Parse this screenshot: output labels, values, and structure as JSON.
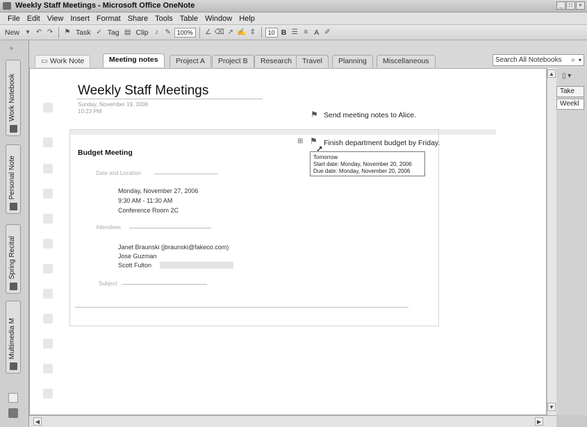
{
  "window": {
    "title": "Weekly Staff Meetings - Microsoft Office OneNote"
  },
  "menu": [
    "File",
    "Edit",
    "View",
    "Insert",
    "Format",
    "Share",
    "Tools",
    "Table",
    "Window",
    "Help"
  ],
  "toolbar": {
    "new_label": "New",
    "task_label": "Task",
    "tag_label": "Tag",
    "clip_label": "Clip",
    "zoom_value": "100%",
    "font_size": "10",
    "bold_label": "B",
    "font_color_label": "A"
  },
  "notebooks": [
    {
      "label": "Work Notebook"
    },
    {
      "label": "Personal Note"
    },
    {
      "label": "Spring Recital"
    },
    {
      "label": "Multimedia M"
    }
  ],
  "section_tabs": [
    {
      "label": "Work Note",
      "active": false
    },
    {
      "label": "Meeting notes",
      "active": true
    },
    {
      "label": "Project A",
      "active": false
    },
    {
      "label": "Project B",
      "active": false
    },
    {
      "label": "Research",
      "active": false
    },
    {
      "label": "Travel",
      "active": false
    },
    {
      "label": "Planning",
      "active": false
    },
    {
      "label": "Miscellaneous",
      "active": false
    }
  ],
  "search": {
    "placeholder": "Search All Notebooks"
  },
  "page": {
    "title": "Weekly Staff Meetings",
    "date": "Sunday, November 19, 2006",
    "time": "10:23 PM",
    "task1": "Send meeting notes to Alice.",
    "task2": "Finish department budget by Friday.",
    "heading": "Budget Meeting",
    "date_location_label": "Date and Location",
    "meeting_date": "Monday, November 27, 2006",
    "meeting_time": "9:30 AM - 11:30 AM",
    "meeting_room": "Conference Room 2C",
    "attendees_label": "Attendees",
    "attendees": [
      "Janet Braunski (jbraunski@fakeco.com)",
      "Jose Guzman",
      "Scott Fulton"
    ],
    "subject_label": "Subject"
  },
  "tooltip": {
    "line1": "Tomorrow",
    "line2": "Start date: Monday, November 20, 2006",
    "line3": "Due date: Monday, November 20, 2006"
  },
  "page_tabs": [
    "Take",
    "Weekl"
  ]
}
